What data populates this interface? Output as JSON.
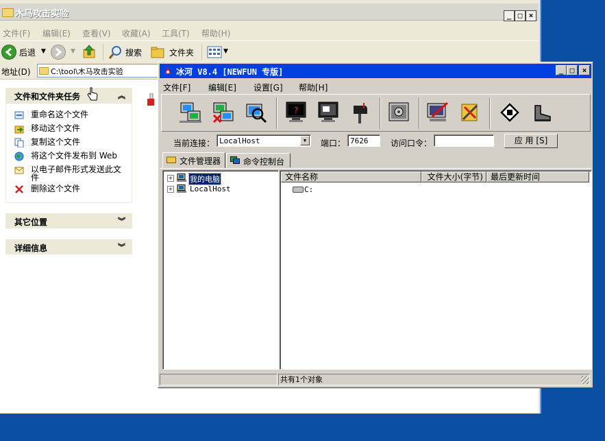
{
  "explorer": {
    "title": "木马攻击实验",
    "menu": [
      "文件(F)",
      "编辑(E)",
      "查看(V)",
      "收藏(A)",
      "工具(T)",
      "帮助(H)"
    ],
    "toolbar": {
      "back": "后退",
      "search": "搜索",
      "folders": "文件夹"
    },
    "address": {
      "label": "地址(D)",
      "value": "C:\\tool\\木马攻击实验"
    },
    "taskpane": {
      "file_tasks_title": "文件和文件夹任务",
      "file_tasks": [
        "重命名这个文件",
        "移动这个文件",
        "复制这个文件",
        "将这个文件发布到 Web",
        "以电子邮件形式发送此文件",
        "删除这个文件"
      ],
      "other_places_title": "其它位置",
      "details_title": "详细信息"
    }
  },
  "bingge": {
    "title": "冰河 V8.4 [NEWFUN 专版]",
    "menu": [
      "文件[F]",
      "编辑[E]",
      "设置[G]",
      "帮助[H]"
    ],
    "toolbar_icons": [
      "add-host-icon",
      "delete-host-icon",
      "search-host-icon",
      "help-screen-icon",
      "screen-view-icon",
      "mailbox-icon",
      "control-panel-icon",
      "edit-screen-icon",
      "tools-icon",
      "home-icon",
      "boot-icon"
    ],
    "connection": {
      "current_label": "当前连接：",
      "current_value": "LocalHost",
      "port_label": "端口：",
      "port_value": "7626",
      "password_label": "访问口令：",
      "password_value": "",
      "apply_label": "应 用 [S]"
    },
    "tabs": [
      "文件管理器",
      "命令控制台"
    ],
    "tree": [
      {
        "label": "我的电脑",
        "selected": true
      },
      {
        "label": "LocalHost",
        "selected": false
      }
    ],
    "list": {
      "columns": [
        "文件名称",
        "文件大小(字节)",
        "最后更新时间"
      ],
      "rows": [
        {
          "name": "C:"
        }
      ]
    },
    "status": "共有1个对象"
  }
}
